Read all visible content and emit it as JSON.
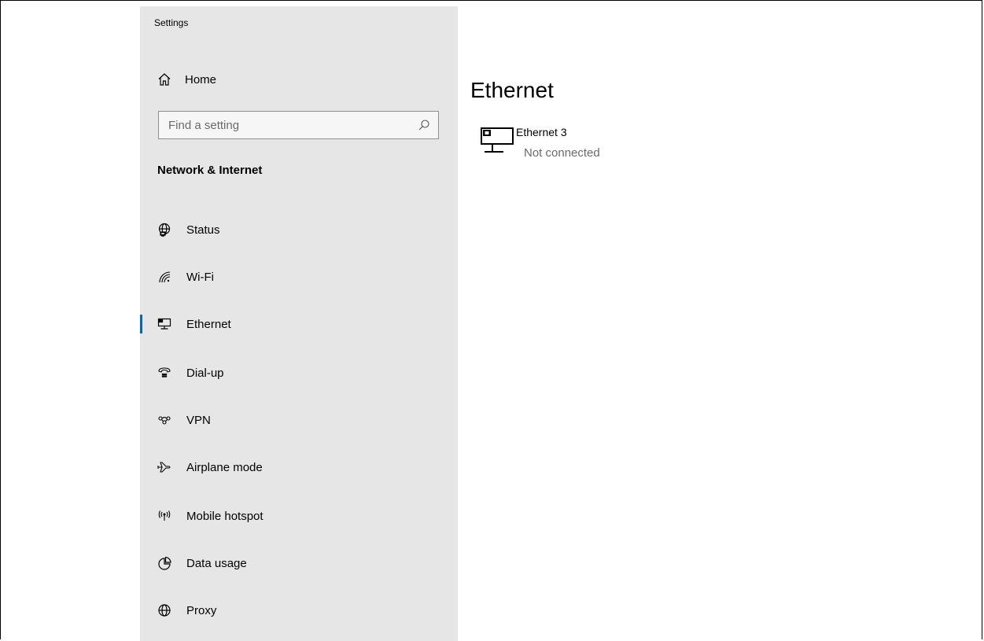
{
  "app": {
    "title": "Settings"
  },
  "sidebar": {
    "home": {
      "label": "Home",
      "icon": "home-icon"
    },
    "search": {
      "placeholder": "Find a setting",
      "icon": "search-icon"
    },
    "section_title": "Network & Internet",
    "items": [
      {
        "label": "Status",
        "icon": "status-icon",
        "selected": false
      },
      {
        "label": "Wi-Fi",
        "icon": "wifi-icon",
        "selected": false
      },
      {
        "label": "Ethernet",
        "icon": "ethernet-icon",
        "selected": true
      },
      {
        "label": "Dial-up",
        "icon": "dialup-icon",
        "selected": false
      },
      {
        "label": "VPN",
        "icon": "vpn-icon",
        "selected": false
      },
      {
        "label": "Airplane mode",
        "icon": "airplane-icon",
        "selected": false
      },
      {
        "label": "Mobile hotspot",
        "icon": "hotspot-icon",
        "selected": false
      },
      {
        "label": "Data usage",
        "icon": "data-usage-icon",
        "selected": false
      },
      {
        "label": "Proxy",
        "icon": "proxy-icon",
        "selected": false
      }
    ]
  },
  "main": {
    "title": "Ethernet",
    "adapter": {
      "name": "Ethernet 3",
      "status": "Not connected",
      "icon": "ethernet-adapter-icon"
    }
  },
  "colors": {
    "accent": "#0067c0",
    "sidebar_bg": "#e6e6e6",
    "secondary_text": "#6b6b6b"
  }
}
